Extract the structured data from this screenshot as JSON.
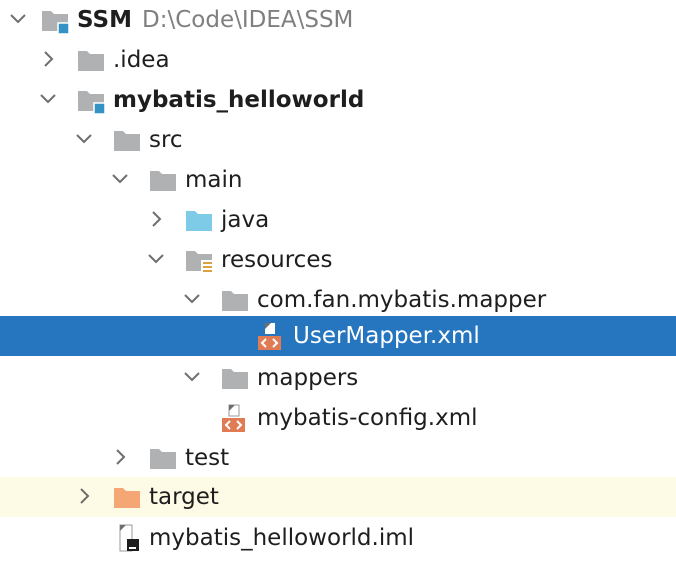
{
  "tree": {
    "root": {
      "label": "SSM",
      "path": "D:\\Code\\IDEA\\SSM",
      "icon": "module-folder-icon",
      "state": "expanded"
    },
    "idea": {
      "label": ".idea",
      "icon": "folder-icon",
      "state": "collapsed"
    },
    "module": {
      "label": "mybatis_helloworld",
      "icon": "module-folder-icon",
      "state": "expanded"
    },
    "src": {
      "label": "src",
      "icon": "folder-icon",
      "state": "expanded"
    },
    "main": {
      "label": "main",
      "icon": "folder-icon",
      "state": "expanded"
    },
    "java": {
      "label": "java",
      "icon": "source-root-folder-icon",
      "state": "collapsed"
    },
    "resources": {
      "label": "resources",
      "icon": "resources-root-folder-icon",
      "state": "expanded"
    },
    "mapper_pkg": {
      "label": "com.fan.mybatis.mapper",
      "icon": "folder-icon",
      "state": "expanded"
    },
    "usermapper": {
      "label": "UserMapper.xml",
      "icon": "xml-file-icon",
      "selected": true
    },
    "mappers": {
      "label": "mappers",
      "icon": "folder-icon",
      "state": "expanded"
    },
    "config": {
      "label": "mybatis-config.xml",
      "icon": "xml-file-icon"
    },
    "test": {
      "label": "test",
      "icon": "folder-icon",
      "state": "collapsed"
    },
    "target": {
      "label": "target",
      "icon": "excluded-folder-icon",
      "state": "collapsed"
    },
    "iml": {
      "label": "mybatis_helloworld.iml",
      "icon": "iml-file-icon"
    }
  },
  "colors": {
    "selection": "#2675bf",
    "excluded_row": "#fdfbe5",
    "folder": "#afb1b3",
    "source_folder": "#7ecbe8",
    "excluded_folder": "#f4a674",
    "module_marker": "#3592c4",
    "xml_badge": "#e07b53"
  }
}
